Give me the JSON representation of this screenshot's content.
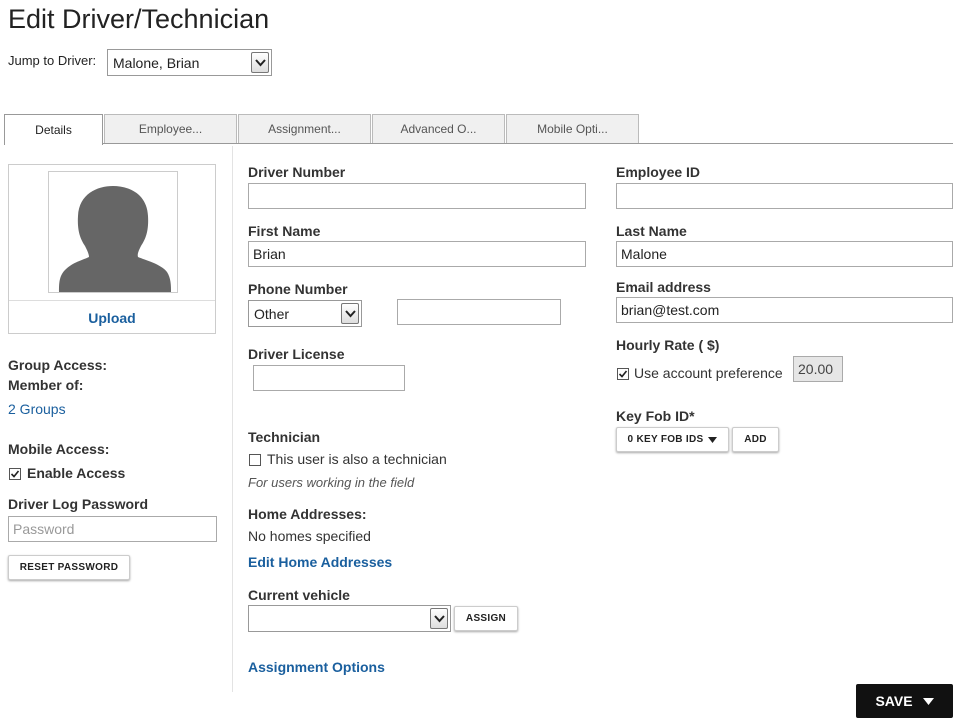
{
  "page": {
    "title": "Edit Driver/Technician"
  },
  "jump": {
    "label": "Jump to Driver:",
    "selected": "Malone, Brian"
  },
  "tabs": [
    {
      "label": "Details"
    },
    {
      "label": "Employee..."
    },
    {
      "label": "Assignment..."
    },
    {
      "label": "Advanced O..."
    },
    {
      "label": "Mobile Opti..."
    }
  ],
  "left": {
    "upload_label": "Upload",
    "group_access_label": "Group Access:",
    "member_of_label": "Member of:",
    "groups_link": "2 Groups",
    "mobile_access_label": "Mobile Access:",
    "enable_access_label": "Enable Access",
    "enable_access_checked": true,
    "driver_log_password_label": "Driver Log Password",
    "password_placeholder": "Password",
    "reset_password_label": "RESET PASSWORD"
  },
  "middle": {
    "driver_number_label": "Driver Number",
    "driver_number_value": "",
    "first_name_label": "First Name",
    "first_name_value": "Brian",
    "phone_number_label": "Phone Number",
    "phone_type_selected": "Other",
    "phone_number_value": "",
    "driver_license_label": "Driver License",
    "driver_license_value": "",
    "technician_label": "Technician",
    "technician_checkbox_label": "This user is also a technician",
    "technician_checked": false,
    "technician_hint": "For users working in the field",
    "home_addresses_label": "Home Addresses:",
    "no_homes_text": "No homes specified",
    "edit_home_link": "Edit Home Addresses",
    "current_vehicle_label": "Current vehicle",
    "current_vehicle_selected": "",
    "assign_label": "ASSIGN",
    "assignment_options_link": "Assignment Options"
  },
  "right": {
    "employee_id_label": "Employee ID",
    "employee_id_value": "",
    "last_name_label": "Last Name",
    "last_name_value": "Malone",
    "email_label": "Email address",
    "email_value": "brian@test.com",
    "hourly_rate_label": "Hourly Rate ( $)",
    "use_account_pref_label": "Use account preference",
    "use_account_pref_checked": true,
    "hourly_rate_value": "20.00",
    "key_fob_label": "Key Fob ID*",
    "key_fob_dropdown_label": "0 KEY FOB IDS",
    "add_label": "ADD"
  },
  "footer": {
    "save_label": "SAVE"
  },
  "colors": {
    "link": "#1a5f9e",
    "save_bg": "#111111"
  }
}
